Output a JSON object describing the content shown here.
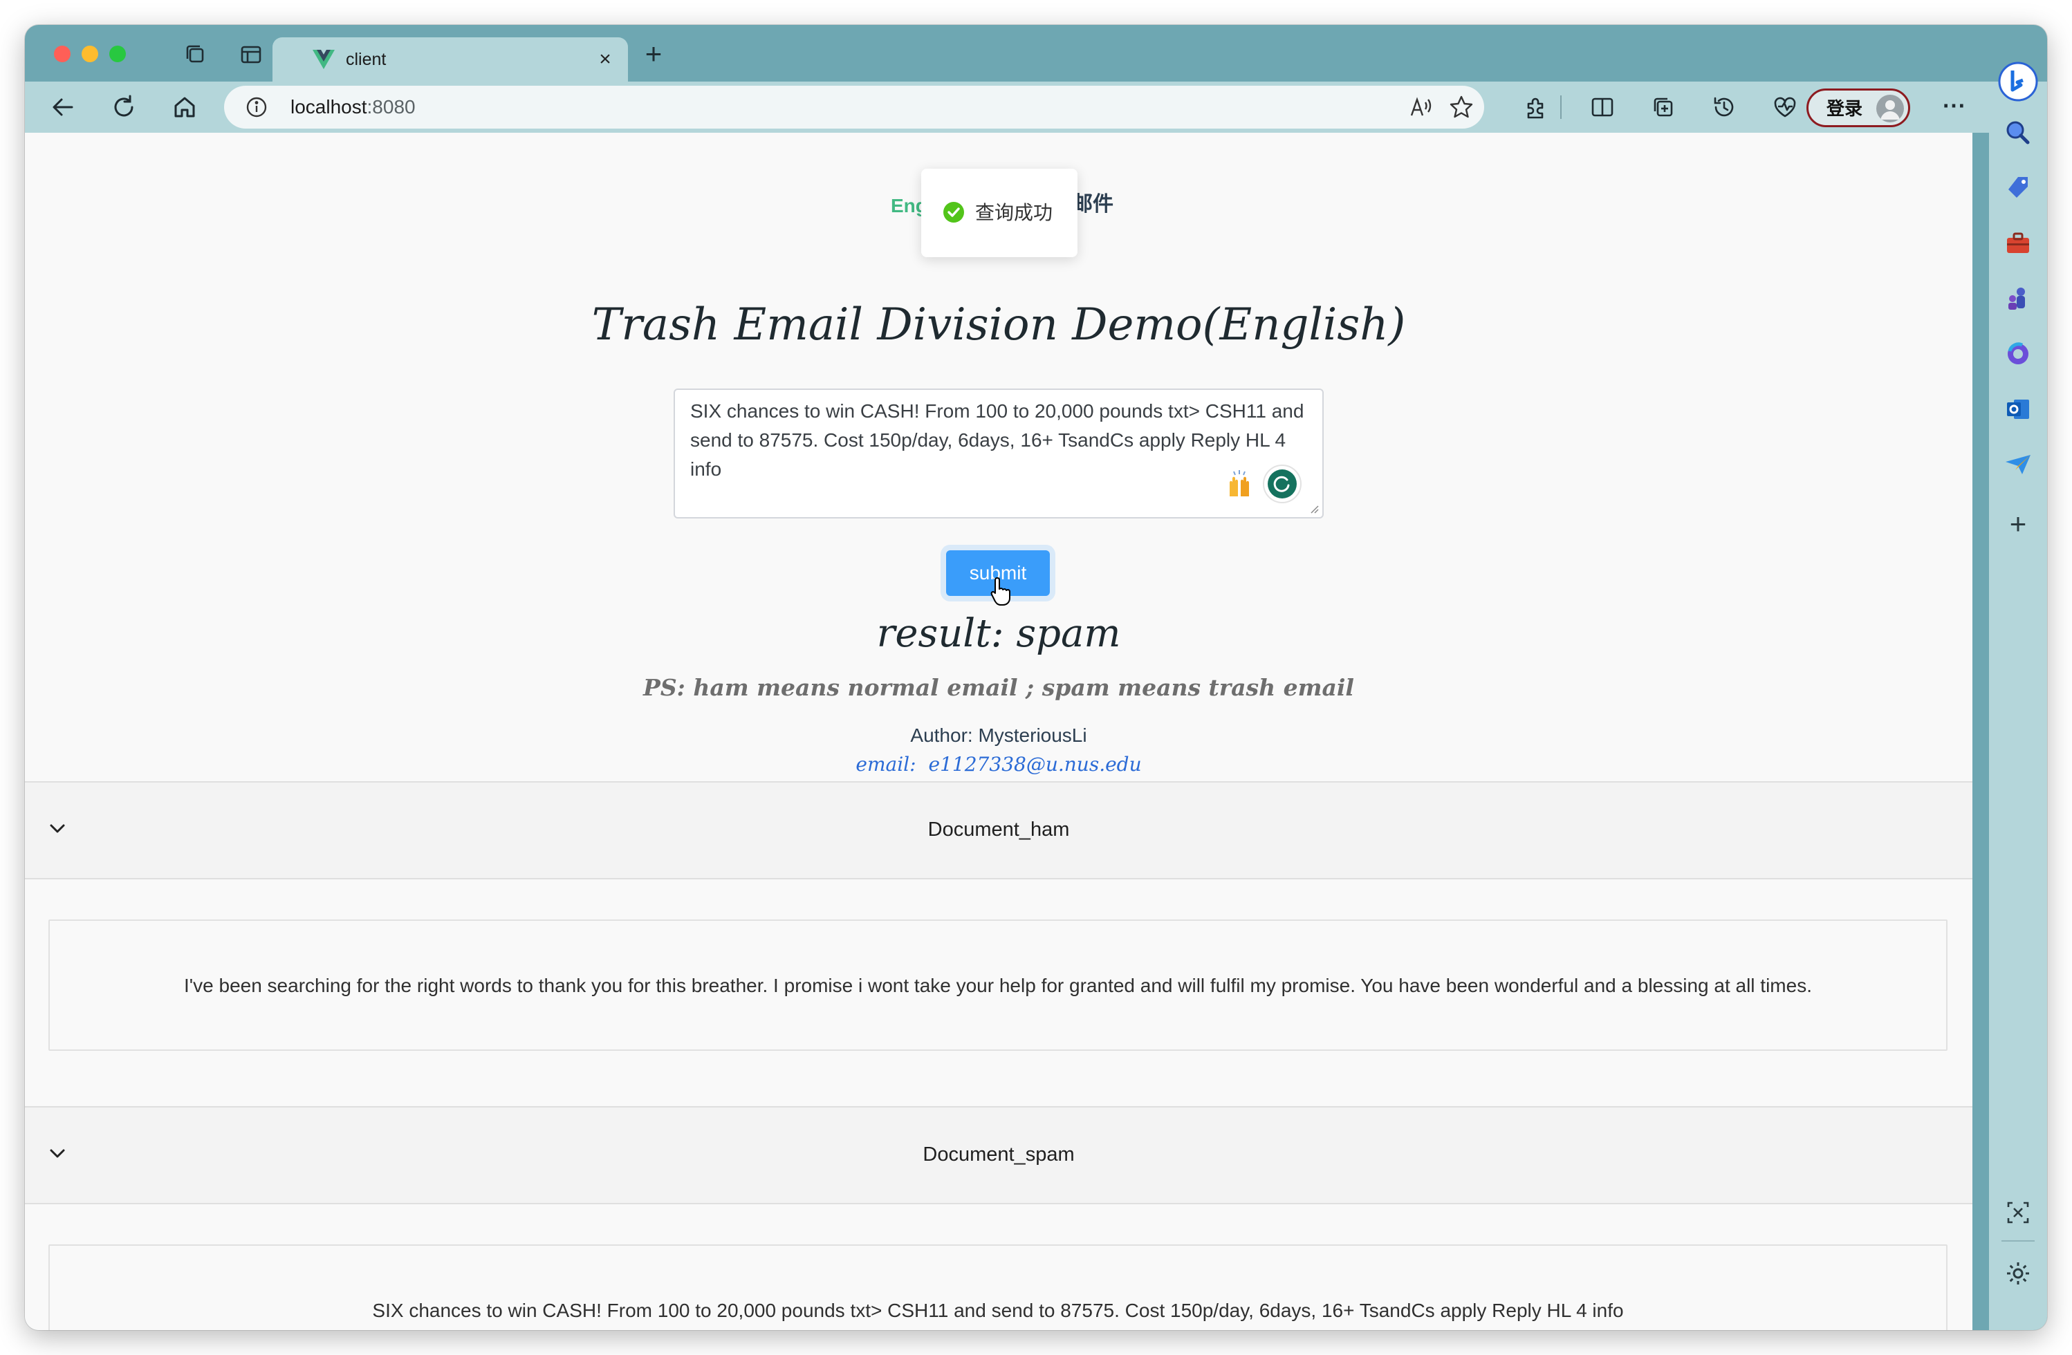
{
  "browser": {
    "tab": {
      "title": "client",
      "close_glyph": "×"
    },
    "new_tab_glyph": "+",
    "url": {
      "host": "localhost",
      "port": ":8080"
    },
    "login_label": "登录",
    "more_glyph": "⋯"
  },
  "page": {
    "lang_switch_en": "Eng",
    "lang_switch_cn": "邮件",
    "toast": "查询成功",
    "title": "Trash Email Division Demo(English)",
    "input_value": "SIX chances to win CASH! From 100 to 20,000 pounds txt> CSH11 and send to 87575. Cost 150p/day, 6days, 16+ TsandCs apply Reply HL 4 info",
    "submit_label": "submit",
    "result": "result: spam",
    "ps": "PS: ham means normal email ; spam means trash email",
    "author": "Author: MysteriousLi",
    "email_label": "email:",
    "email_address": "e1127338@u.nus.edu"
  },
  "documents": [
    {
      "title": "Document_ham",
      "text": "I've been searching for the right words to thank you for this breather. I promise i wont take your help for granted and will fulfil my promise. You have been wonderful and a blessing at all times."
    },
    {
      "title": "Document_spam",
      "text": "SIX chances to win CASH! From 100 to 20,000 pounds txt> CSH11 and send to 87575. Cost 150p/day, 6days, 16+ TsandCs apply Reply HL 4 info"
    }
  ],
  "colors": {
    "accent_green": "#42b983",
    "submit_blue": "#3a9dfa",
    "toolbar": "#b4d6da",
    "tabstrip": "#6ea7b2"
  }
}
